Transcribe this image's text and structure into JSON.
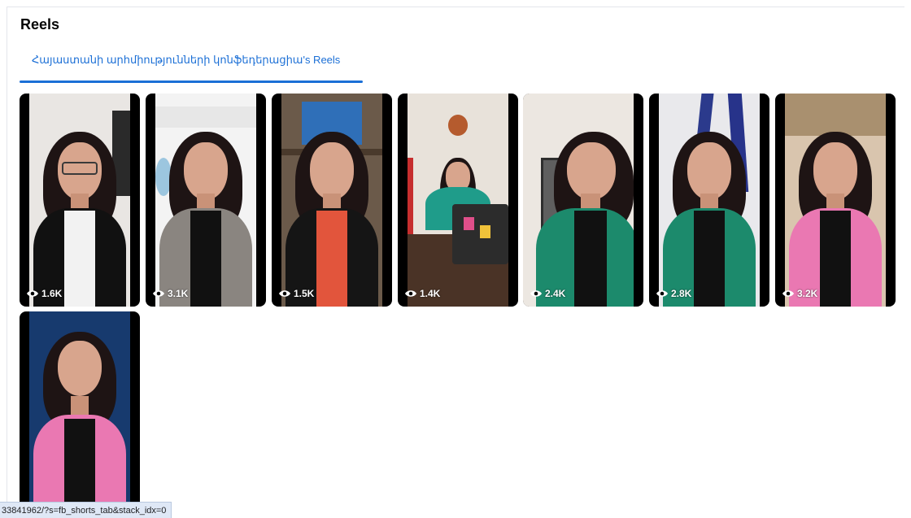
{
  "section": {
    "title": "Reels"
  },
  "tab": {
    "label": "Հայաստանի արհմիությունների կոնֆեդերացիա's Reels"
  },
  "reels": [
    {
      "views": "1.6K"
    },
    {
      "views": "3.1K"
    },
    {
      "views": "1.5K"
    },
    {
      "views": "1.4K"
    },
    {
      "views": "2.4K"
    },
    {
      "views": "2.8K"
    },
    {
      "views": "3.2K"
    },
    {
      "views": ""
    }
  ],
  "status_bar": {
    "url": "33841962/?s=fb_shorts_tab&stack_idx=0"
  },
  "colors": {
    "link_blue": "#1b6fd6",
    "status_bg": "#dfe8f6"
  }
}
